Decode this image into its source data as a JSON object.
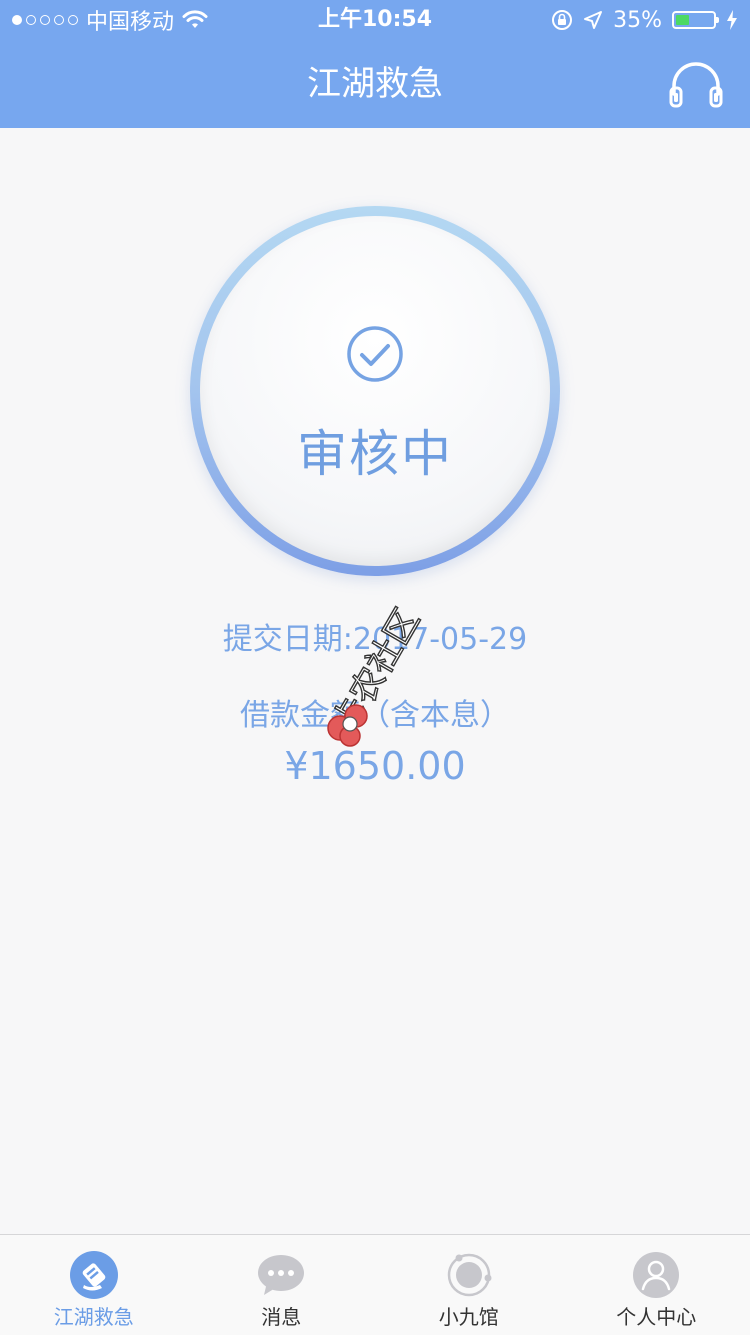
{
  "status_bar": {
    "carrier": "中国移动",
    "time": "上午10:54",
    "battery_percent": "35%",
    "battery_level": 0.35,
    "icons": [
      "signal-dots",
      "wifi-icon",
      "orientation-lock-icon",
      "location-icon",
      "battery-icon",
      "charging-icon"
    ]
  },
  "nav": {
    "title": "江湖救急",
    "right_icon": "headset-icon"
  },
  "status": {
    "icon": "check-circle-icon",
    "label": "审核中"
  },
  "info": {
    "submit_date": "提交日期:2017-05-29",
    "loan_label": "借款金额（含本息）",
    "loan_amount": "¥1650.00"
  },
  "watermark": {
    "text": "卡农社区"
  },
  "tabs": [
    {
      "label": "江湖救急",
      "icon": "emergency-icon",
      "active": true
    },
    {
      "label": "消息",
      "icon": "message-icon",
      "active": false
    },
    {
      "label": "小九馆",
      "icon": "planet-icon",
      "active": false
    },
    {
      "label": "个人中心",
      "icon": "user-icon",
      "active": false
    }
  ],
  "colors": {
    "accent": "#77a7ef",
    "text_blue": "#7aa6e6",
    "active_tab": "#6b9de6",
    "inactive_icon": "#c7c7cc"
  }
}
